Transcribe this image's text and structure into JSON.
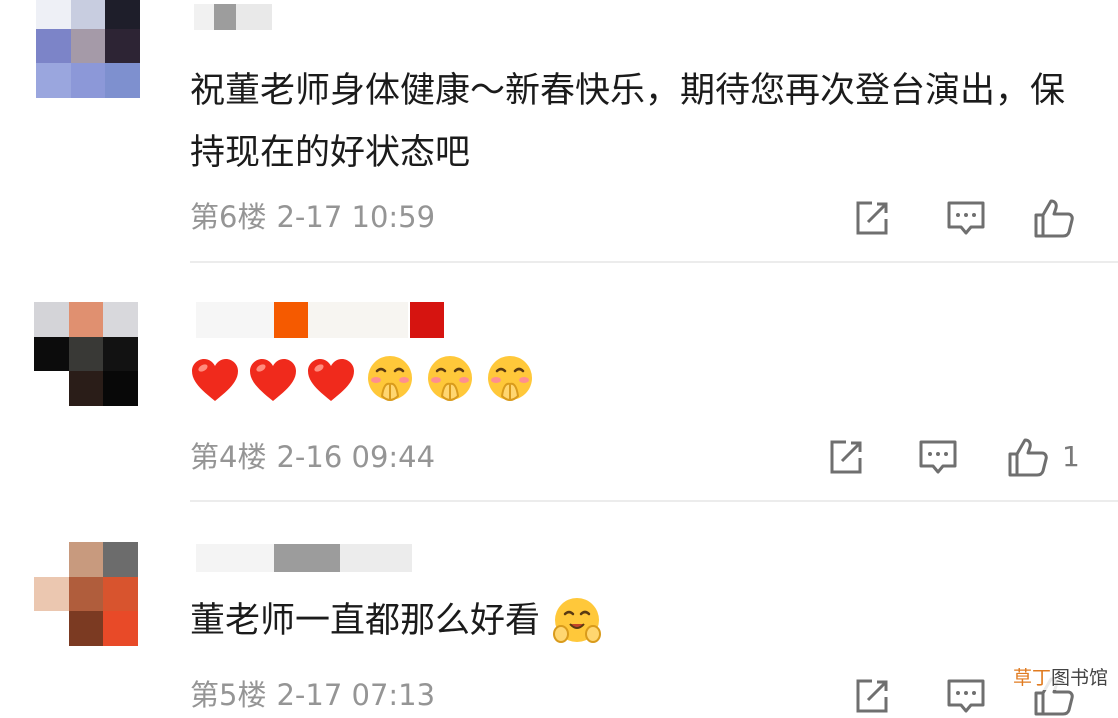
{
  "comments": [
    {
      "text": "祝董老师身体健康～新春快乐，期待您再次登台演出，保持现在的好状态吧",
      "floor": "第6楼",
      "timestamp": "2-17 10:59",
      "like_count": ""
    },
    {
      "emojis": [
        "red-heart",
        "red-heart",
        "red-heart",
        "praying-face",
        "praying-face",
        "praying-face"
      ],
      "floor": "第4楼",
      "timestamp": "2-16 09:44",
      "like_count": "1"
    },
    {
      "text": "董老师一直都那么好看",
      "emojis": [
        "smiling-face-with-hands"
      ],
      "floor": "第5楼",
      "timestamp": "2-17 07:13",
      "like_count": ""
    }
  ],
  "icons": {
    "share": "share-icon",
    "reply": "comment-icon",
    "like": "thumbs-up-icon"
  },
  "watermark": {
    "part1": "草丁",
    "part2": "图书馆"
  },
  "colors": {
    "text": "#1b1b1b",
    "meta": "#959595",
    "divider": "#ececec",
    "icon": "#6f6f6f"
  }
}
